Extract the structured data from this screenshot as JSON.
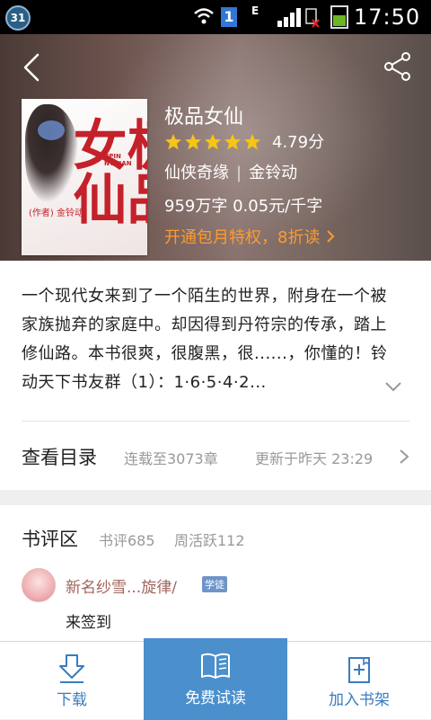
{
  "status_bar": {
    "left_badge": "31",
    "sim1_label": "1",
    "network": "E",
    "time": "17:50"
  },
  "header": {
    "back_icon": "chevron-left-icon",
    "share_icon": "share-icon"
  },
  "book": {
    "cover_title_art": "极品女仙",
    "cover_pinyin_art": "JIPIN NVXIAN",
    "cover_author_art": "(作者) 金铃动",
    "title": "极品女仙",
    "stars": 5,
    "rating": "4.79分",
    "genre": "仙侠奇缘",
    "author": "金铃动",
    "wordcount_price": "959万字  0.05元/千字",
    "promo": "开通包月特权，8折读",
    "star_color": "#f5c518",
    "promo_color": "#ff9a2e"
  },
  "description": {
    "text": "一个现代女来到了一个陌生的世界，附身在一个被家族抛弃的家庭中。却因得到丹符宗的传承，踏上修仙路。本书很爽，很腹黑，很......，你懂的！铃动天下书友群（1）：1·6·5·4·2..."
  },
  "toc": {
    "label": "查看目录",
    "serial": "连载至3073章",
    "updated": "更新于昨天 23:29"
  },
  "reviews": {
    "label": "书评区",
    "review_count": "书评685",
    "active_count": "周活跃112",
    "items": [
      {
        "username": "新名纱雪...旋律/",
        "badge": "学徒",
        "comment": "来签到"
      }
    ]
  },
  "bottom_bar": {
    "download_label": "下载",
    "read_label": "免费试读",
    "shelf_label": "加入书架",
    "accent": "#4b8fcc"
  }
}
